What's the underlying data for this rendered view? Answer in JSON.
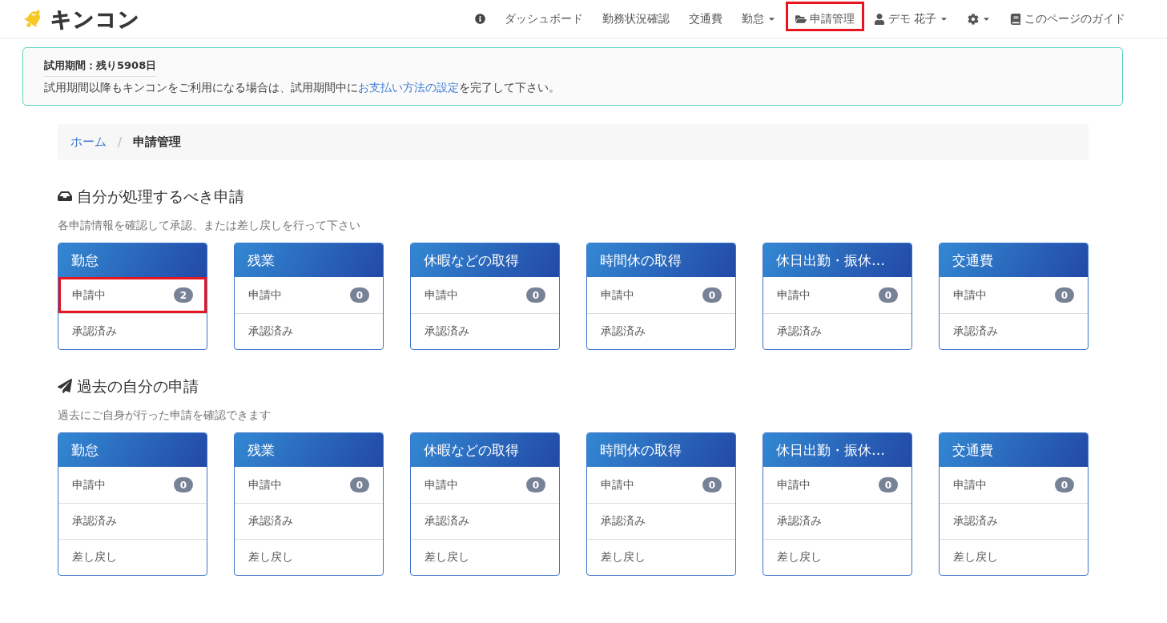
{
  "header": {
    "logo": {
      "text": "キンコン"
    },
    "nav": [
      {
        "kind": "info",
        "dropdown": false,
        "highlighted": false
      },
      {
        "kind": "text",
        "label": "ダッシュボード",
        "dropdown": false,
        "highlighted": false
      },
      {
        "kind": "text",
        "label": "勤務状況確認",
        "dropdown": false,
        "highlighted": false
      },
      {
        "kind": "text",
        "label": "交通費",
        "dropdown": false,
        "highlighted": false
      },
      {
        "kind": "text",
        "label": "勤怠",
        "dropdown": true,
        "highlighted": false
      },
      {
        "kind": "folder",
        "label": "申請管理",
        "dropdown": false,
        "highlighted": true
      },
      {
        "kind": "user",
        "label": "デモ 花子",
        "dropdown": true,
        "highlighted": false
      },
      {
        "kind": "gear",
        "dropdown": true,
        "highlighted": false
      },
      {
        "kind": "book",
        "label": "このページのガイド",
        "dropdown": false,
        "highlighted": false
      }
    ]
  },
  "alert": {
    "title": "試用期間：残り5908日",
    "message_start": "試用期間以降もキンコンをご利用になる場合は、試用期間中に",
    "link": "お支払い方法の設定",
    "message_end": "を完了して下さい。"
  },
  "breadcrumb": {
    "separator": "/",
    "items": [
      {
        "label": "ホーム",
        "current": false
      },
      {
        "label": "申請管理",
        "current": true
      }
    ]
  },
  "sections": [
    {
      "kind": "inbox",
      "title": "自分が処理するべき申請",
      "subtitle": "各申請情報を確認して承認、または差し戻しを行って下さい",
      "cards": [
        {
          "title": "勤怠",
          "rows": [
            {
              "label": "申請中",
              "count": "2",
              "highlighted": true
            },
            {
              "label": "承認済み",
              "highlighted": false
            }
          ]
        },
        {
          "title": "残業",
          "rows": [
            {
              "label": "申請中",
              "count": "0",
              "highlighted": false
            },
            {
              "label": "承認済み",
              "highlighted": false
            }
          ]
        },
        {
          "title": "休暇などの取得",
          "rows": [
            {
              "label": "申請中",
              "count": "0",
              "highlighted": false
            },
            {
              "label": "承認済み",
              "highlighted": false
            }
          ]
        },
        {
          "title": "時間休の取得",
          "rows": [
            {
              "label": "申請中",
              "count": "0",
              "highlighted": false
            },
            {
              "label": "承認済み",
              "highlighted": false
            }
          ]
        },
        {
          "title": "休日出勤・振休…",
          "rows": [
            {
              "label": "申請中",
              "count": "0",
              "highlighted": false
            },
            {
              "label": "承認済み",
              "highlighted": false
            }
          ]
        },
        {
          "title": "交通費",
          "rows": [
            {
              "label": "申請中",
              "count": "0",
              "highlighted": false
            },
            {
              "label": "承認済み",
              "highlighted": false
            }
          ]
        }
      ]
    },
    {
      "kind": "sent",
      "title": "過去の自分の申請",
      "subtitle": "過去にご自身が行った申請を確認できます",
      "cards": [
        {
          "title": "勤怠",
          "rows": [
            {
              "label": "申請中",
              "count": "0",
              "highlighted": false
            },
            {
              "label": "承認済み",
              "highlighted": false
            },
            {
              "label": "差し戻し",
              "highlighted": false
            }
          ]
        },
        {
          "title": "残業",
          "rows": [
            {
              "label": "申請中",
              "count": "0",
              "highlighted": false
            },
            {
              "label": "承認済み",
              "highlighted": false
            },
            {
              "label": "差し戻し",
              "highlighted": false
            }
          ]
        },
        {
          "title": "休暇などの取得",
          "rows": [
            {
              "label": "申請中",
              "count": "0",
              "highlighted": false
            },
            {
              "label": "承認済み",
              "highlighted": false
            },
            {
              "label": "差し戻し",
              "highlighted": false
            }
          ]
        },
        {
          "title": "時間休の取得",
          "rows": [
            {
              "label": "申請中",
              "count": "0",
              "highlighted": false
            },
            {
              "label": "承認済み",
              "highlighted": false
            },
            {
              "label": "差し戻し",
              "highlighted": false
            }
          ]
        },
        {
          "title": "休日出勤・振休…",
          "rows": [
            {
              "label": "申請中",
              "count": "0",
              "highlighted": false
            },
            {
              "label": "承認済み",
              "highlighted": false
            },
            {
              "label": "差し戻し",
              "highlighted": false
            }
          ]
        },
        {
          "title": "交通費",
          "rows": [
            {
              "label": "申請中",
              "count": "0",
              "highlighted": false
            },
            {
              "label": "承認済み",
              "highlighted": false
            },
            {
              "label": "差し戻し",
              "highlighted": false
            }
          ]
        }
      ]
    }
  ]
}
